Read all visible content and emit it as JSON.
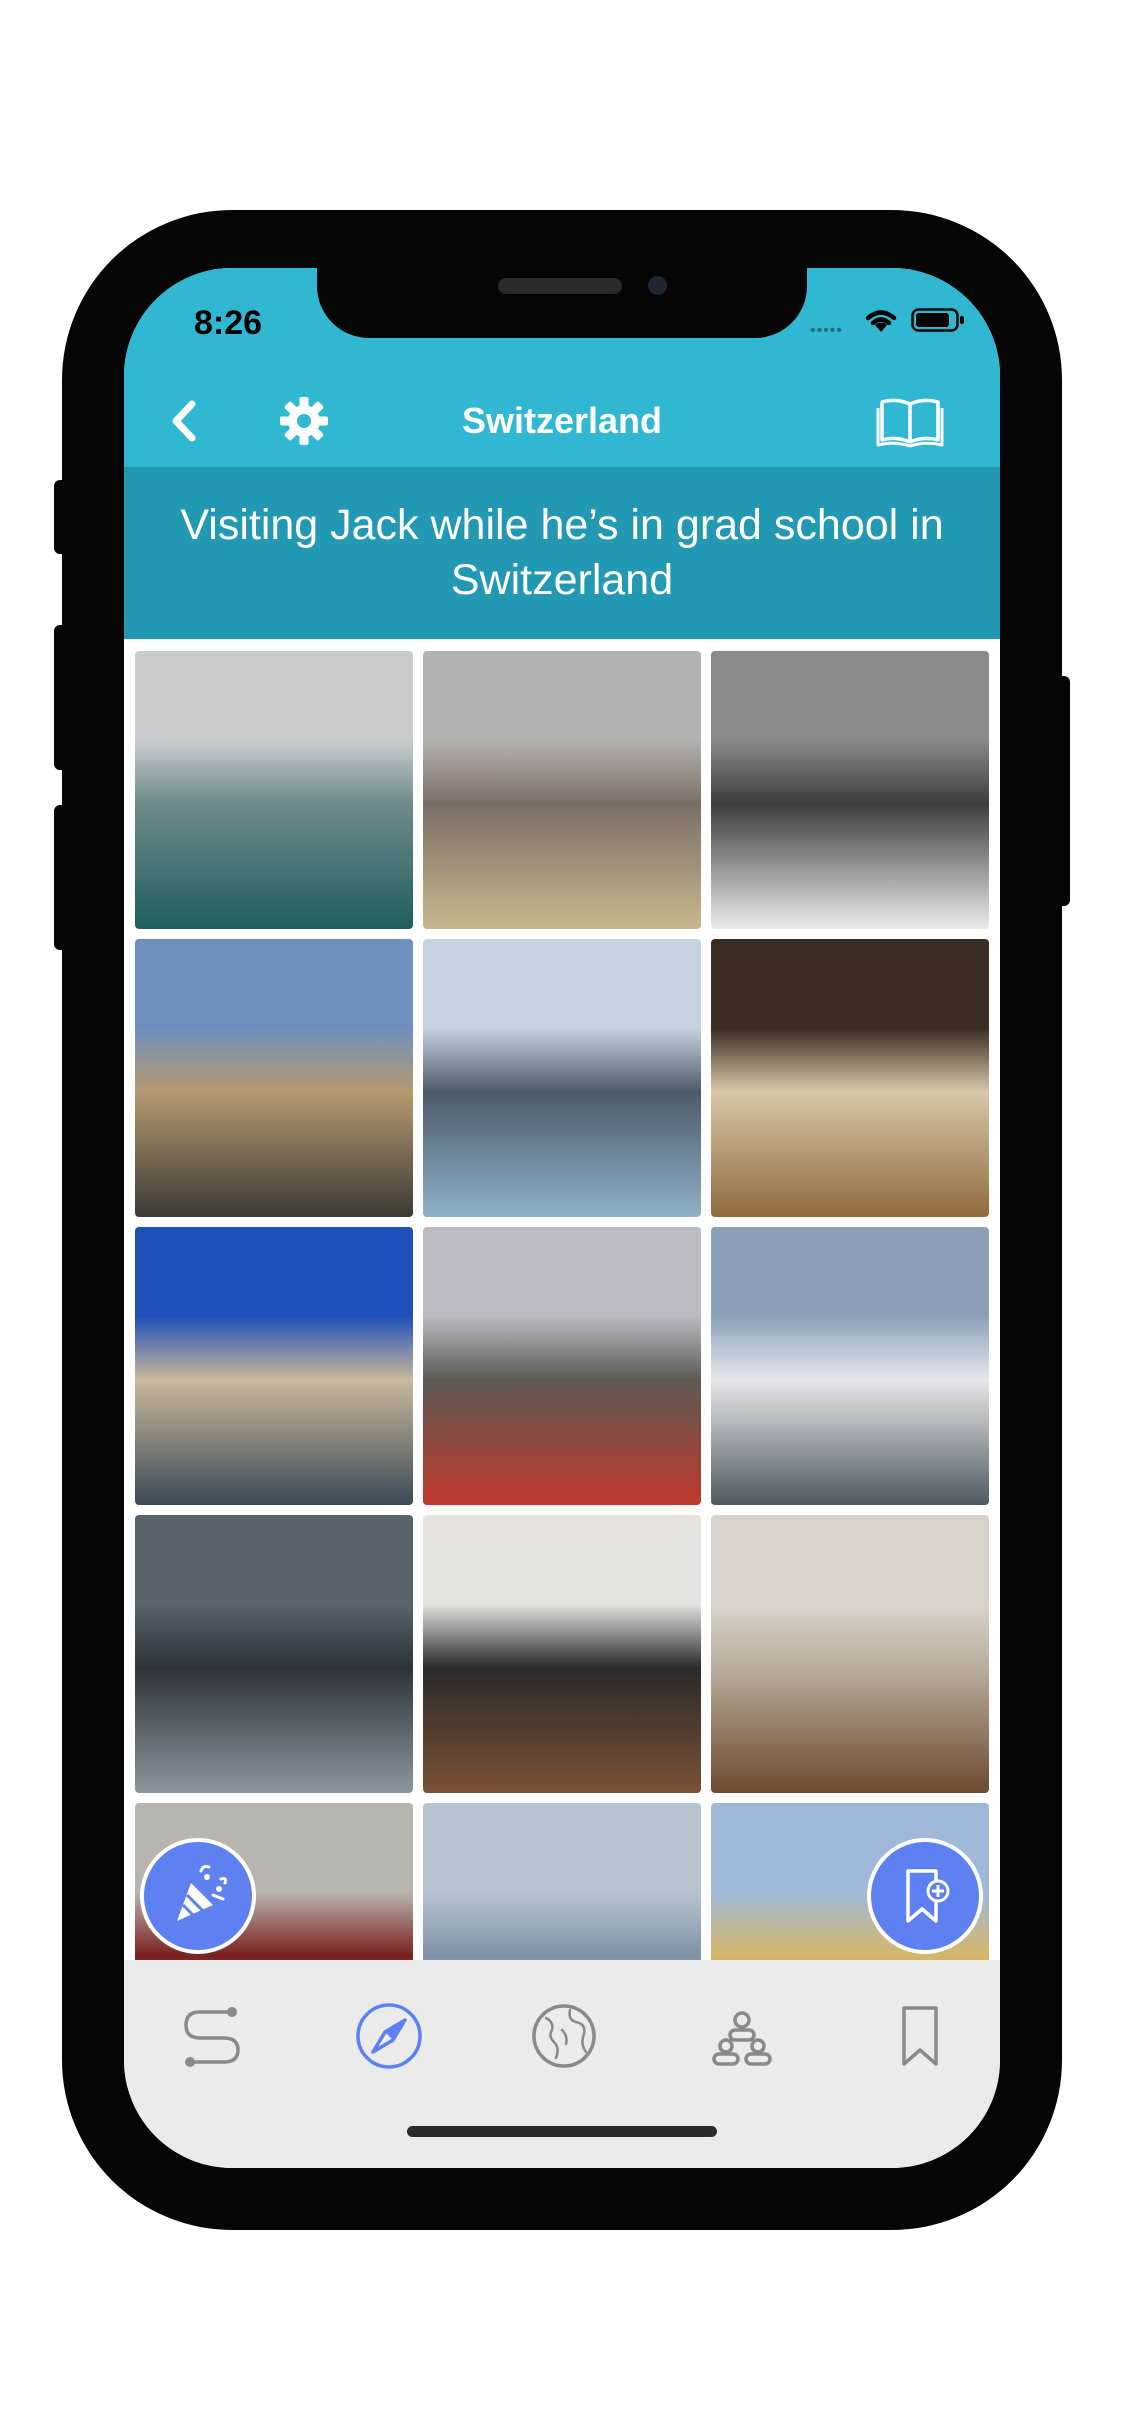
{
  "status_bar": {
    "time": "8:26",
    "signal": "•••••"
  },
  "nav": {
    "title": "Switzerland",
    "back_icon": "chevron-left-icon",
    "settings_icon": "gear-icon",
    "journal_icon": "open-book-icon"
  },
  "subtitle": "Visiting Jack while he’s in grad school in Switzerland",
  "photos": [
    {
      "scene": "foggy-river-town",
      "colors": [
        "#c9cdd0",
        "#6f8a8a",
        "#1f5e5e"
      ]
    },
    {
      "scene": "snowy-rooftops",
      "colors": [
        "#b4b2ae",
        "#7a6f66",
        "#c8b78e"
      ]
    },
    {
      "scene": "monument-snow",
      "colors": [
        "#8a8a86",
        "#3d3d3a",
        "#ebebe9"
      ]
    },
    {
      "scene": "grand-hotel",
      "colors": [
        "#6e8fbd",
        "#b59a6f",
        "#3b3a36"
      ]
    },
    {
      "scene": "church-snowy-park",
      "colors": [
        "#c5d2e0",
        "#4c5a6a",
        "#8fb1c8"
      ]
    },
    {
      "scene": "cafe-bicycles",
      "colors": [
        "#3a2e24",
        "#d8c7a8",
        "#8f6a3c"
      ]
    },
    {
      "scene": "lakeside-town",
      "colors": [
        "#1f4fb8",
        "#c9b89d",
        "#3a4a55"
      ]
    },
    {
      "scene": "cobblestone-street",
      "colors": [
        "#b9bcc0",
        "#5e5a55",
        "#c0392b"
      ]
    },
    {
      "scene": "alpine-lake-view",
      "colors": [
        "#8ba0b8",
        "#e6e8ea",
        "#4e5a5f"
      ]
    },
    {
      "scene": "swan-on-water",
      "colors": [
        "#58636a",
        "#2b3338",
        "#8c979d"
      ]
    },
    {
      "scene": "gallery-painting-dark",
      "colors": [
        "#e6e3de",
        "#2a2a2a",
        "#7a5236"
      ]
    },
    {
      "scene": "gallery-painting-trees",
      "colors": [
        "#d9d4cb",
        "#b8ad9c",
        "#6e4a30"
      ]
    },
    {
      "scene": "graffiti-wall",
      "colors": [
        "#b8b4ae",
        "#7a1f1f",
        "#e5e2dc"
      ]
    },
    {
      "scene": "mountain-horizon",
      "colors": [
        "#b7c3cf",
        "#7f93a6",
        "#e7edf2"
      ]
    },
    {
      "scene": "yellow-castle",
      "colors": [
        "#9fb8d8",
        "#d6b76a",
        "#8a3a2a"
      ]
    }
  ],
  "fab": {
    "celebrate_icon": "party-popper-icon",
    "bookmark_add_icon": "bookmark-add-icon"
  },
  "tabs": [
    {
      "id": "route",
      "icon": "route-icon",
      "active": false
    },
    {
      "id": "explore",
      "icon": "compass-icon",
      "active": true
    },
    {
      "id": "globe",
      "icon": "globe-icon",
      "active": false
    },
    {
      "id": "people",
      "icon": "people-icon",
      "active": false
    },
    {
      "id": "saved",
      "icon": "bookmark-icon",
      "active": false
    }
  ],
  "colors": {
    "header": "#30b8d3",
    "banner": "#2298b3",
    "accent": "#5f80f0",
    "tab_inactive": "#8a8a8a",
    "tab_bar": "#ebebeb"
  }
}
